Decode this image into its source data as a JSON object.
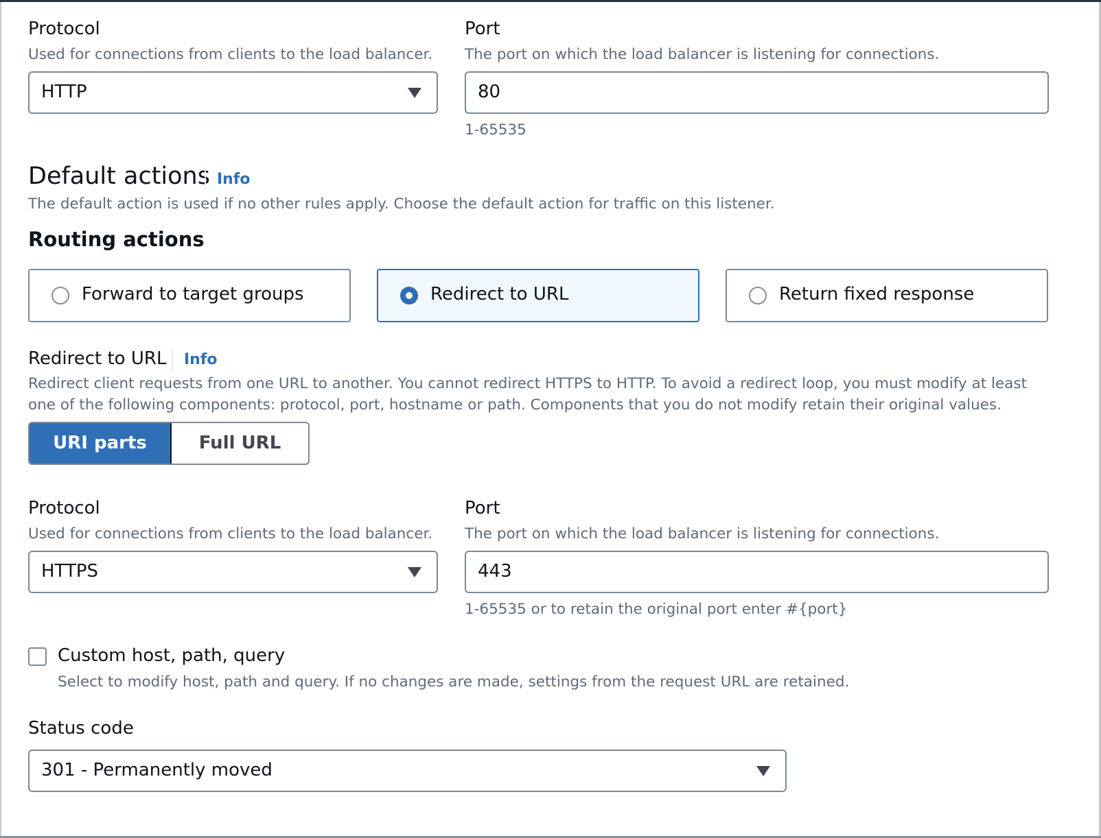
{
  "listener": {
    "protocol": {
      "label": "Protocol",
      "description": "Used for connections from clients to the load balancer.",
      "value": "HTTP"
    },
    "port": {
      "label": "Port",
      "description": "The port on which the load balancer is listening for connections.",
      "value": "80",
      "hint": "1-65535"
    }
  },
  "default_actions": {
    "title": "Default actions",
    "info": "Info",
    "description": "The default action is used if no other rules apply. Choose the default action for traffic on this listener.",
    "routing_title": "Routing actions",
    "options": [
      {
        "label": "Forward to target groups",
        "selected": false
      },
      {
        "label": "Redirect to URL",
        "selected": true
      },
      {
        "label": "Return fixed response",
        "selected": false
      }
    ]
  },
  "redirect": {
    "title": "Redirect to URL",
    "info": "Info",
    "description_line1": "Redirect client requests from one URL to another. You cannot redirect HTTPS to HTTP. To avoid a redirect loop, you must modify at least",
    "description_line2": "one of the following components: protocol, port, hostname or path. Components that you do not modify retain their original values.",
    "mode_options": [
      {
        "label": "URI parts",
        "selected": true
      },
      {
        "label": "Full URL",
        "selected": false
      }
    ],
    "protocol": {
      "label": "Protocol",
      "description": "Used for connections from clients to the load balancer.",
      "value": "HTTPS"
    },
    "port": {
      "label": "Port",
      "description": "The port on which the load balancer is listening for connections.",
      "value": "443",
      "hint": "1-65535 or to retain the original port enter #{port}"
    },
    "custom": {
      "label": "Custom host, path, query",
      "description": "Select to modify host, path and query. If no changes are made, settings from the request URL are retained.",
      "checked": false
    },
    "status_code": {
      "label": "Status code",
      "value": "301 - Permanently moved"
    }
  },
  "colors": {
    "accent": "#2f6fb6",
    "selected_tile_bg": "#f1f8fe",
    "border": "#7d8998",
    "secondary_text": "#5f6b7a"
  }
}
